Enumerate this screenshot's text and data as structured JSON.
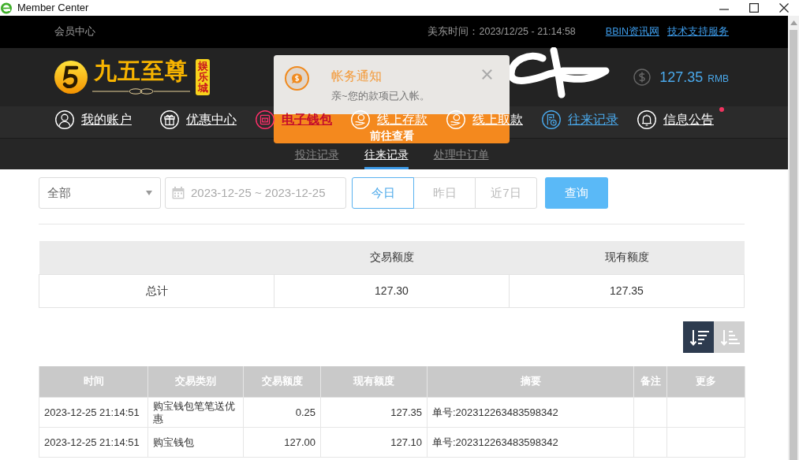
{
  "window": {
    "title": "Member Center"
  },
  "top_bar": {
    "label": "会员中心",
    "clock": "美东时间：2023/12/25 - 21:14:58",
    "links": [
      "BBIN资讯网",
      "技术支持服务"
    ]
  },
  "header": {
    "logo": {
      "name": "九五至尊",
      "tag": "娱乐城"
    },
    "balance": "127.35",
    "currency": "RMB"
  },
  "nav": {
    "items": [
      {
        "label": "我的账户",
        "kind": "account",
        "selected": false,
        "highlighted": false,
        "dot": false
      },
      {
        "label": "优惠中心",
        "kind": "gift",
        "selected": false,
        "highlighted": false,
        "dot": false
      },
      {
        "label": "电子钱包",
        "kind": "wallet",
        "selected": false,
        "highlighted": true,
        "dot": false
      },
      {
        "label": "线上存款",
        "kind": "deposit",
        "selected": false,
        "highlighted": false,
        "dot": false
      },
      {
        "label": "线上取款",
        "kind": "withdraw",
        "selected": false,
        "highlighted": false,
        "dot": false
      },
      {
        "label": "往来记录",
        "kind": "records",
        "selected": true,
        "highlighted": false,
        "dot": false
      },
      {
        "label": "信息公告",
        "kind": "bell",
        "selected": false,
        "highlighted": false,
        "dot": true
      }
    ]
  },
  "sub_nav": {
    "tabs": [
      {
        "label": "投注记录",
        "selected": false
      },
      {
        "label": "往来记录",
        "selected": true
      },
      {
        "label": "处理中订单",
        "selected": false
      }
    ]
  },
  "notification": {
    "title": "帐务通知",
    "message": "亲~您的款项已入帐。",
    "action": "前往查看"
  },
  "filters": {
    "type_select": {
      "value": "全部"
    },
    "date_range": {
      "value": "2023-12-25 ~ 2023-12-25"
    },
    "ranges": [
      {
        "label": "今日",
        "selected": true
      },
      {
        "label": "昨日",
        "selected": false
      },
      {
        "label": "近7日",
        "selected": false
      }
    ],
    "query_button": "查询"
  },
  "summary": {
    "columns": [
      "交易额度",
      "现有额度"
    ],
    "rows": [
      {
        "label": "总计",
        "cells": [
          "127.30",
          "127.35"
        ]
      }
    ]
  },
  "sort_buttons": [
    {
      "kind": "descending",
      "selected": true
    },
    {
      "kind": "ascending",
      "selected": false
    }
  ],
  "records": {
    "columns": [
      "时间",
      "交易类别",
      "交易额度",
      "现有额度",
      "摘要",
      "备注",
      "更多"
    ],
    "rows": [
      {
        "cells": [
          "2023-12-25 21:14:51",
          "购宝钱包笔笔送优惠",
          "0.25",
          "127.35",
          "单号:202312263483598342"
        ]
      },
      {
        "cells": [
          "2023-12-25 21:14:51",
          "购宝钱包",
          "127.00",
          "127.10",
          "单号:202312263483598342"
        ]
      }
    ]
  }
}
